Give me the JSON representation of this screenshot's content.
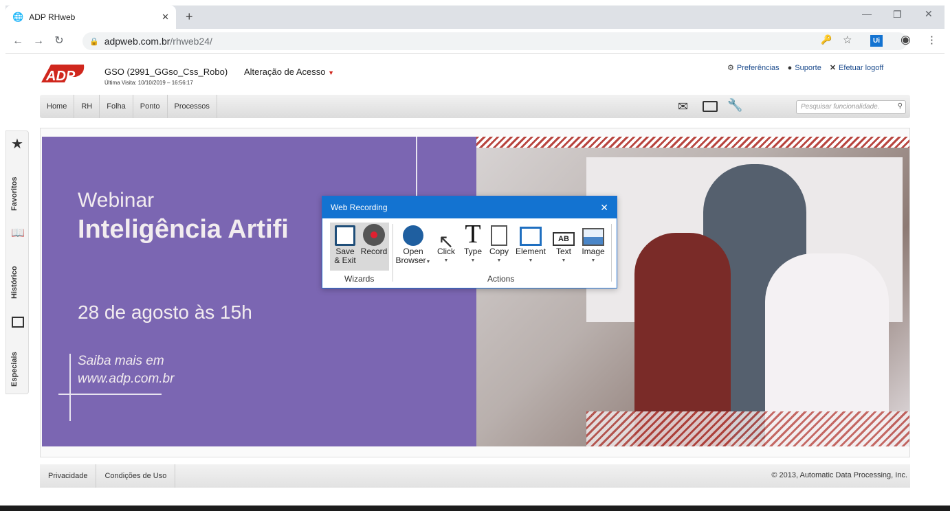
{
  "browser": {
    "tab_title": "ADP RHweb",
    "url_host": "adpweb.com.br",
    "url_path": "/rhweb24/"
  },
  "header": {
    "company": "GSO (2991_GGso_Css_Robo)",
    "last_visit": "Última Visita: 10/10/2019 – 16:56:17",
    "access_menu": "Alteração de Acesso",
    "preferences": "Preferências",
    "support": "Suporte",
    "logoff": "Efetuar logoff"
  },
  "menu": {
    "items": [
      "Home",
      "RH",
      "Folha",
      "Ponto",
      "Processos"
    ],
    "search_placeholder": "Pesquisar funcionalidade."
  },
  "side_tabs": [
    "Favoritos",
    "Histórico",
    "Especiais"
  ],
  "banner": {
    "line1": "Webinar",
    "line2": "Inteligência Artifi",
    "date": "28 de agosto às 15h",
    "more1": "Saiba mais em",
    "more2": "www.adp.com.br"
  },
  "web_recording": {
    "title": "Web Recording",
    "save_exit_1": "Save",
    "save_exit_2": "& Exit",
    "record": "Record",
    "open_browser_1": "Open",
    "open_browser_2": "Browser",
    "click": "Click",
    "type": "Type",
    "copy": "Copy",
    "element": "Element",
    "text": "Text",
    "image": "Image",
    "group_wizards": "Wizards",
    "group_actions": "Actions"
  },
  "footer": {
    "privacy": "Privacidade",
    "terms": "Condições de Uso",
    "copyright": "© 2013, Automatic Data Processing, Inc."
  },
  "colors": {
    "adp_red": "#d0271d",
    "banner_purple": "#7b66b2",
    "dialog_blue": "#1373d1"
  }
}
